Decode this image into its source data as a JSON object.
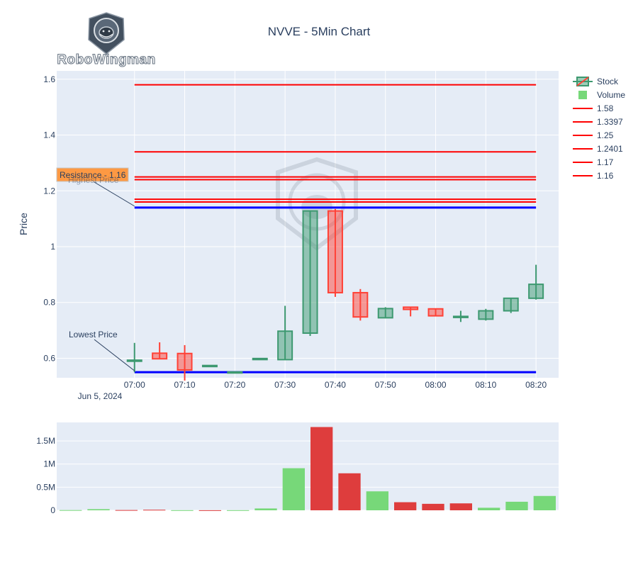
{
  "chart_data": {
    "type": "candlestick",
    "title": "NVVE - 5Min Chart",
    "logo_text": "RoboWingman",
    "date_label": "Jun 5, 2024",
    "ylabel": "Price",
    "ylim": [
      0.53,
      1.63
    ],
    "yticks": [
      0.6,
      0.8,
      1,
      1.2,
      1.4,
      1.6
    ],
    "ytick_labels": [
      "0.6",
      "0.8",
      "1",
      "1.2",
      "1.4",
      "1.6"
    ],
    "xticks": [
      "07:00",
      "07:10",
      "07:20",
      "07:30",
      "07:40",
      "07:50",
      "08:00",
      "08:10",
      "08:20"
    ],
    "xlim_minutes": [
      -15.5,
      84.5
    ],
    "colors": {
      "increasing": "#3d9970",
      "decreasing": "#ff4136",
      "volume_up": "#77d879",
      "volume_down": "#de3d3d",
      "resistance": "#ff0000",
      "extreme": "#0000ff",
      "plot_bg": "#e5ecf6",
      "annotation_bg": "#ff9030"
    },
    "candles": [
      {
        "t": "07:00",
        "open": 0.59,
        "high": 0.655,
        "low": 0.55,
        "close": 0.593
      },
      {
        "t": "07:05",
        "open": 0.618,
        "high": 0.657,
        "low": 0.6,
        "close": 0.598
      },
      {
        "t": "07:10",
        "open": 0.617,
        "high": 0.647,
        "low": 0.52,
        "close": 0.558
      },
      {
        "t": "07:15",
        "open": 0.573,
        "high": 0.574,
        "low": 0.572,
        "close": 0.574
      },
      {
        "t": "07:20",
        "open": 0.551,
        "high": 0.551,
        "low": 0.55,
        "close": 0.551
      },
      {
        "t": "07:25",
        "open": 0.598,
        "high": 0.599,
        "low": 0.597,
        "close": 0.599
      },
      {
        "t": "07:30",
        "open": 0.595,
        "high": 0.788,
        "low": 0.595,
        "close": 0.697
      },
      {
        "t": "07:35",
        "open": 0.69,
        "high": 1.13,
        "low": 0.68,
        "close": 1.128
      },
      {
        "t": "07:40",
        "open": 1.128,
        "high": 1.135,
        "low": 0.82,
        "close": 0.835
      },
      {
        "t": "07:45",
        "open": 0.835,
        "high": 0.848,
        "low": 0.735,
        "close": 0.748
      },
      {
        "t": "07:50",
        "open": 0.745,
        "high": 0.783,
        "low": 0.743,
        "close": 0.778
      },
      {
        "t": "07:55",
        "open": 0.783,
        "high": 0.785,
        "low": 0.75,
        "close": 0.775
      },
      {
        "t": "08:00",
        "open": 0.777,
        "high": 0.777,
        "low": 0.75,
        "close": 0.752
      },
      {
        "t": "08:05",
        "open": 0.75,
        "high": 0.77,
        "low": 0.73,
        "close": 0.75
      },
      {
        "t": "08:10",
        "open": 0.74,
        "high": 0.777,
        "low": 0.735,
        "close": 0.77
      },
      {
        "t": "08:15",
        "open": 0.77,
        "high": 0.816,
        "low": 0.762,
        "close": 0.815
      },
      {
        "t": "08:20",
        "open": 0.815,
        "high": 0.935,
        "low": 0.81,
        "close": 0.865
      }
    ],
    "volume": {
      "yticks": [
        0,
        500000,
        1000000,
        1500000
      ],
      "ytick_labels": [
        "0",
        "0.5M",
        "1M",
        "1.5M"
      ],
      "ylim": [
        0,
        1900000
      ],
      "values": [
        5000,
        25000,
        6000,
        12000,
        3000,
        2000,
        3000,
        40000,
        910000,
        1800000,
        800000,
        410000,
        175000,
        140000,
        150000,
        55000,
        185000,
        310000
      ],
      "directions": [
        "up",
        "up",
        "down",
        "down",
        "up",
        "down",
        "up",
        "up",
        "up",
        "down",
        "down",
        "up",
        "down",
        "down",
        "down",
        "up",
        "up",
        "up"
      ]
    },
    "horizontal_lines": [
      {
        "value": 1.58,
        "label": "1.58",
        "color": "#ff0000"
      },
      {
        "value": 1.3397,
        "label": "1.3397",
        "color": "#ff0000"
      },
      {
        "value": 1.25,
        "label": "1.25",
        "color": "#ff0000"
      },
      {
        "value": 1.2401,
        "label": "1.2401",
        "color": "#ff0000"
      },
      {
        "value": 1.17,
        "label": "1.17",
        "color": "#ff0000"
      },
      {
        "value": 1.16,
        "label": "1.16",
        "color": "#ff0000"
      }
    ],
    "extreme_lines": [
      {
        "value": 1.14,
        "color": "#0000ff"
      },
      {
        "value": 0.55,
        "color": "#0000ff"
      }
    ],
    "legend": [
      {
        "label": "Stock",
        "kind": "candle"
      },
      {
        "label": "Volume",
        "kind": "bar"
      },
      {
        "label": "1.58",
        "kind": "line"
      },
      {
        "label": "1.3397",
        "kind": "line"
      },
      {
        "label": "1.25",
        "kind": "line"
      },
      {
        "label": "1.2401",
        "kind": "line"
      },
      {
        "label": "1.17",
        "kind": "line"
      },
      {
        "label": "1.16",
        "kind": "line"
      }
    ],
    "annotations": [
      {
        "text": "Resistance - 1.16",
        "value": 1.16,
        "kind": "resistance"
      },
      {
        "text": "Highest Price",
        "value": 1.14,
        "kind": "high"
      },
      {
        "text": "Lowest Price",
        "value": 0.55,
        "kind": "low"
      }
    ]
  }
}
